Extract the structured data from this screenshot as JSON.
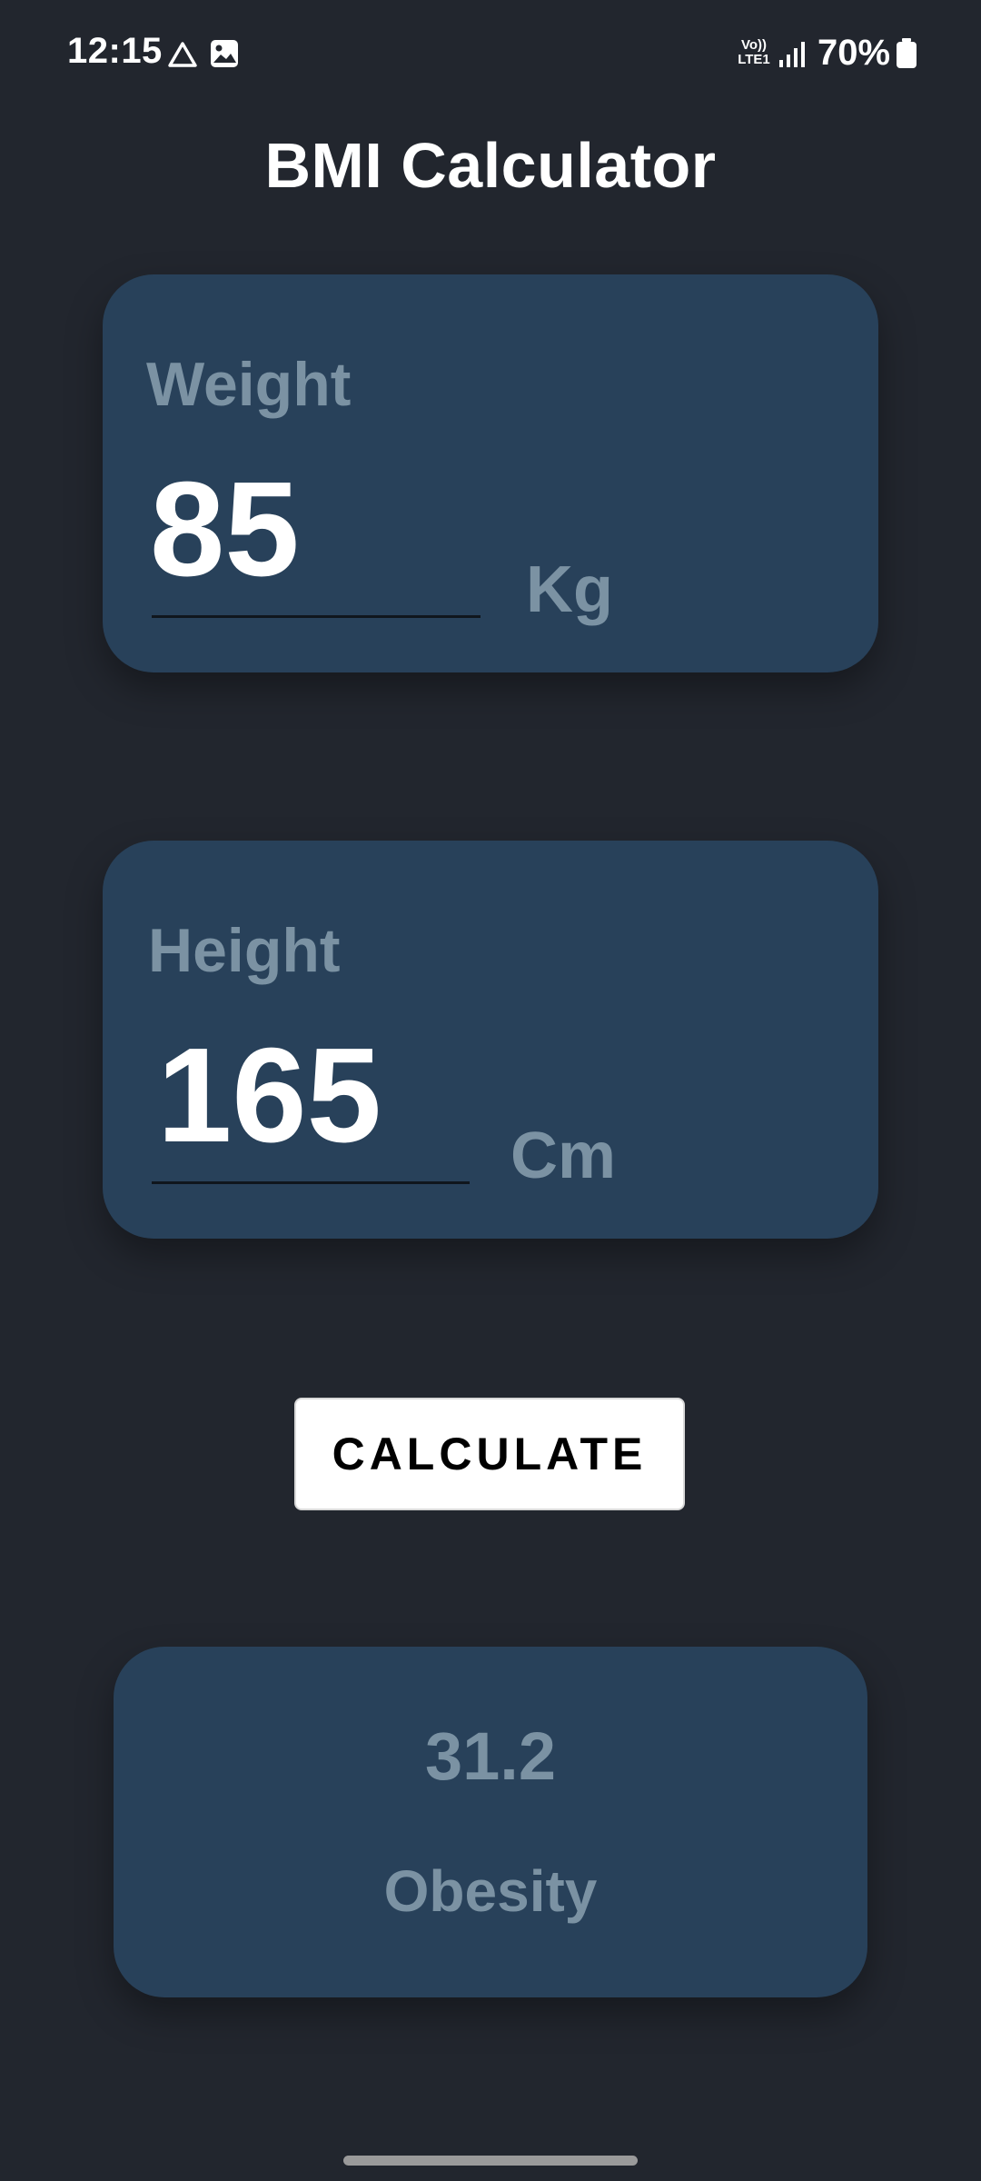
{
  "status_bar": {
    "time": "12:15",
    "network_label_top": "Vo))",
    "network_label_bottom": "LTE1",
    "battery_percent": "70%",
    "icons": [
      "drive-icon",
      "gallery-icon",
      "signal-icon",
      "battery-icon"
    ]
  },
  "app": {
    "title": "BMI Calculator"
  },
  "weight": {
    "label": "Weight",
    "value": "85",
    "unit": "Kg"
  },
  "height": {
    "label": "Height",
    "value": "165",
    "unit": "Cm"
  },
  "actions": {
    "calculate_label": "CALCULATE"
  },
  "result": {
    "bmi": "31.2",
    "category": "Obesity"
  },
  "colors": {
    "background": "#22262e",
    "card": "#28415a",
    "muted_text": "#7b92a3",
    "primary_text": "#ffffff",
    "button_bg": "#ffffff"
  }
}
